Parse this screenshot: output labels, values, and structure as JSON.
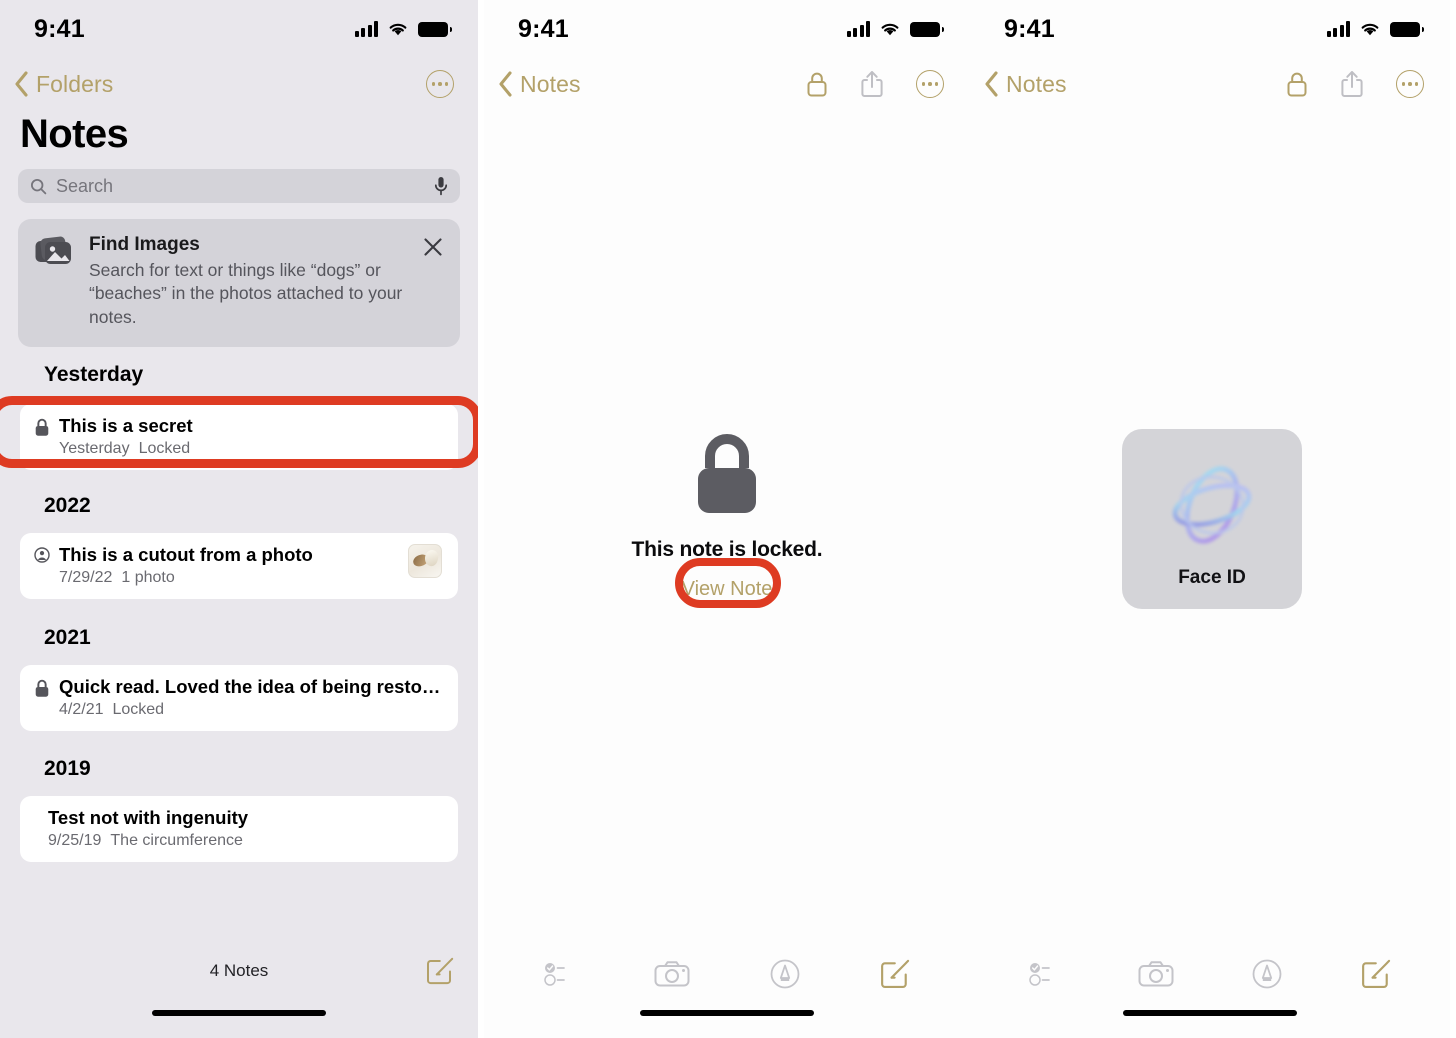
{
  "statusbar": {
    "time": "9:41"
  },
  "panel_list": {
    "nav": {
      "back_label": "Folders",
      "more_icon": "ellipsis-circle-icon"
    },
    "title": "Notes",
    "search": {
      "placeholder": "Search",
      "mic_icon": "microphone-icon",
      "search_icon": "search-icon"
    },
    "banner": {
      "icon": "photos-stack-icon",
      "title": "Find Images",
      "description": "Search for text or things like “dogs” or “beaches” in the photos attached to your notes.",
      "close_icon": "close-icon"
    },
    "sections": [
      {
        "heading": "Yesterday",
        "notes": [
          {
            "lead_icon": "lock-icon",
            "title": "This is a secret",
            "date": "Yesterday",
            "detail": "Locked",
            "thumbnail": false,
            "highlighted": true
          }
        ]
      },
      {
        "heading": "2022",
        "notes": [
          {
            "lead_icon": "shared-person-icon",
            "title": "This is a cutout from a photo",
            "date": "7/29/22",
            "detail": "1 photo",
            "thumbnail": true,
            "highlighted": false
          }
        ]
      },
      {
        "heading": "2021",
        "notes": [
          {
            "lead_icon": "lock-icon",
            "title": "Quick read. Loved the idea of being restored, a…",
            "date": "4/2/21",
            "detail": "Locked",
            "thumbnail": false,
            "highlighted": false
          }
        ]
      },
      {
        "heading": "2019",
        "notes": [
          {
            "lead_icon": "none",
            "title": "Test not with ingenuity",
            "date": "9/25/19",
            "detail": "The circumference",
            "thumbnail": false,
            "highlighted": false
          }
        ]
      }
    ],
    "footer": {
      "count_label": "4 Notes",
      "compose_icon": "compose-icon"
    }
  },
  "panel_locked": {
    "nav": {
      "back_label": "Notes",
      "lock_icon": "lock-icon",
      "share_icon": "share-icon",
      "more_icon": "ellipsis-circle-icon"
    },
    "lock_glyph": "padlock-icon",
    "message": "This note is locked.",
    "action_label": "View Note",
    "toolbar": [
      "checklist-icon",
      "camera-icon",
      "markup-pen-icon",
      "compose-icon"
    ]
  },
  "panel_faceid": {
    "nav": {
      "back_label": "Notes",
      "lock_icon": "lock-icon",
      "share_icon": "share-icon",
      "more_icon": "ellipsis-circle-icon"
    },
    "card": {
      "glyph": "faceid-globe-icon",
      "label": "Face ID"
    },
    "toolbar": [
      "checklist-icon",
      "camera-icon",
      "markup-pen-icon",
      "compose-icon"
    ]
  },
  "colors": {
    "accent_gold": "#B3A169",
    "highlight_red": "#DE3B22",
    "list_background": "#E9E7EC",
    "card_white": "#FFFFFF",
    "banner_gray": "#D4D3D9",
    "faceid_card": "#D4D4D8"
  }
}
